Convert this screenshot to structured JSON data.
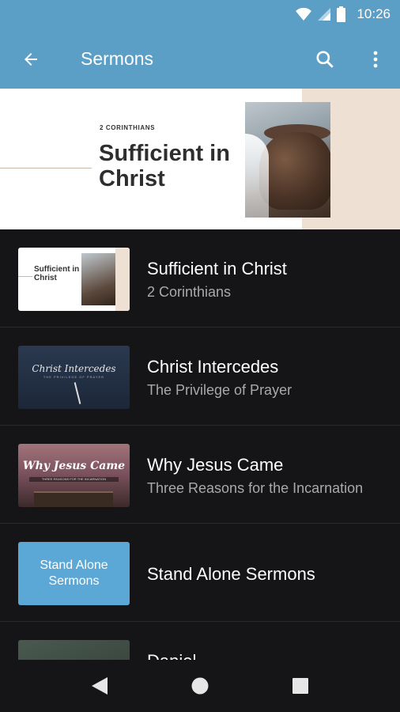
{
  "status_bar": {
    "time": "10:26"
  },
  "app_bar": {
    "title": "Sermons",
    "icons": [
      "back-arrow-icon",
      "search-icon",
      "more-vert-icon"
    ]
  },
  "hero": {
    "kicker": "2 CORINTHIANS",
    "title": "Sufficient in Christ"
  },
  "sermons": [
    {
      "title": "Sufficient in Christ",
      "subtitle": "2 Corinthians",
      "thumb_text": "Sufficient in Christ"
    },
    {
      "title": "Christ Intercedes",
      "subtitle": "The Privilege of Prayer",
      "thumb_text": "Christ Intercedes",
      "thumb_sub": "THE PRIVILEGE OF PRAYER"
    },
    {
      "title": "Why Jesus Came",
      "subtitle": "Three Reasons for the Incarnation",
      "thumb_text": "Why Jesus Came",
      "thumb_sub": "THREE REASONS FOR THE INCARNATION"
    },
    {
      "title": "Stand Alone Sermons",
      "subtitle": "",
      "thumb_text": "Stand Alone Sermons"
    },
    {
      "title": "Daniel",
      "subtitle": ""
    }
  ],
  "colors": {
    "accent": "#5b9fc6",
    "background": "#151517",
    "stand_alone_tile": "#5ba8d6"
  }
}
